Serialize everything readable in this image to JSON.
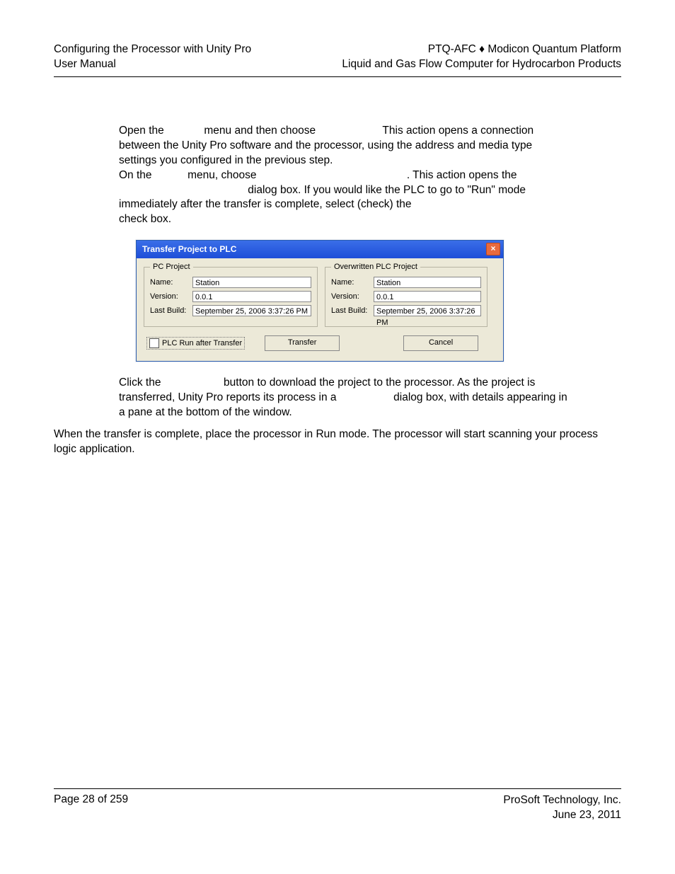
{
  "header": {
    "left_line1": "Configuring the Processor with Unity Pro",
    "left_line2": "User Manual",
    "right_line1_a": "PTQ-AFC ",
    "right_line1_diamond": "♦",
    "right_line1_b": " Modicon Quantum Platform",
    "right_line2": "Liquid and Gas Flow Computer for Hydrocarbon Products"
  },
  "para1": {
    "t1": "Open the ",
    "t2": " menu and then choose ",
    "t3": " This action opens a connection between the Unity Pro software and the processor, using the address and media type settings you configured in the previous step.",
    "t4": "On the ",
    "t5": " menu, choose ",
    "t6": ". This action opens the ",
    "t7": " dialog box. If you would like the PLC to go to \"Run\" mode immediately after the transfer is complete, select (check) the ",
    "t8": " check box."
  },
  "dialog": {
    "title": "Transfer Project to PLC",
    "group_left_legend": "PC Project",
    "group_right_legend": "Overwritten PLC Project",
    "labels": {
      "name": "Name:",
      "version": "Version:",
      "last_build": "Last Build:"
    },
    "pc": {
      "name": "Station",
      "version": "0.0.1",
      "last_build": "September 25, 2006 3:37:26 PM"
    },
    "plc": {
      "name": "Station",
      "version": "0.0.1",
      "last_build": "September 25, 2006 3:37:26 PM"
    },
    "checkbox_label": "PLC Run after Transfer",
    "transfer_btn": "Transfer",
    "cancel_btn": "Cancel"
  },
  "para2": {
    "t1": "Click the ",
    "t2": " button to download the project to the processor. As the project is transferred, Unity Pro reports its process in a ",
    "t3": " dialog box, with details appearing in a pane at the bottom of the window."
  },
  "para3": "When the transfer is complete, place the processor in Run mode. The processor will start scanning your process logic application.",
  "footer": {
    "page": "Page 28 of 259",
    "company": "ProSoft Technology, Inc.",
    "date": "June 23, 2011"
  }
}
